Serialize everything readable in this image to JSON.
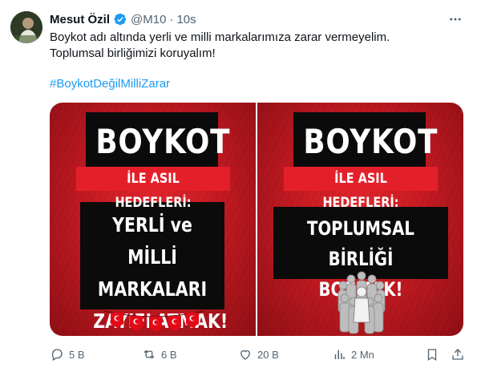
{
  "author": {
    "name": "Mesut Özil",
    "handle": "@M10",
    "separator": "·",
    "time": "10s"
  },
  "tweet": {
    "text": "Boykot adı altında yerli ve milli markalarımıza zarar vermeyelim. Toplumsal birliğimizi koruyalım!",
    "hashtag": "#BoykotDeğilMilliZarar"
  },
  "media": {
    "left": {
      "title": "BOYKOT",
      "label": "İLE ASIL HEDEFLERİ:",
      "lines": [
        "YERLİ ve MİLLİ",
        "MARKALARI",
        "ZAYIFLATMAK!"
      ]
    },
    "right": {
      "title": "BOYKOT",
      "label": "İLE ASIL HEDEFLERİ:",
      "lines": [
        "TOPLUMSAL BİRLİĞİ",
        "BOZMAK!"
      ]
    }
  },
  "actions": {
    "replies": "5 B",
    "reposts": "6 B",
    "likes": "20 B",
    "views": "2 Mn"
  },
  "colors": {
    "accent": "#1d9bf0",
    "muted": "#536471",
    "poster_red": "#d81f26"
  }
}
